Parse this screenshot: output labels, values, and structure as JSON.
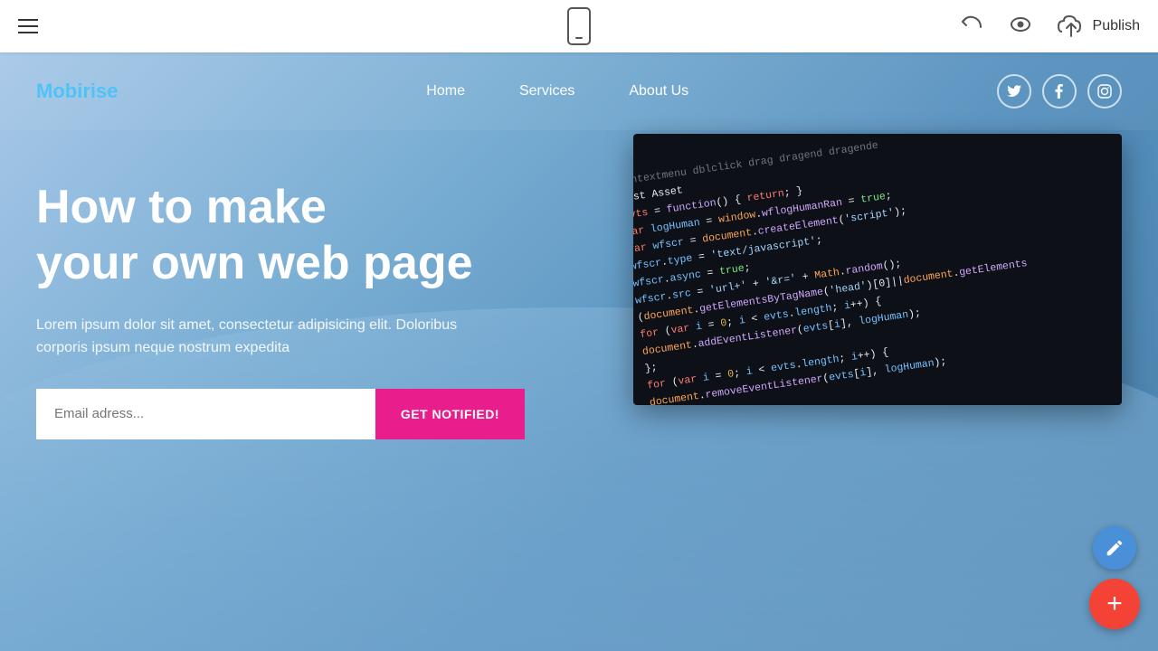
{
  "toolbar": {
    "publish_label": "Publish"
  },
  "site": {
    "logo": "Mobirise",
    "nav": {
      "home": "Home",
      "services": "Services",
      "about_us": "About Us"
    },
    "hero": {
      "title_line1": "How to make",
      "title_line2": "your own web page",
      "subtitle": "Lorem ipsum dolor sit amet, consectetur adipisicing elit. Doloribus corporis ipsum neque nostrum expedita",
      "email_placeholder": "Email adress...",
      "notify_btn": "GET NOTIFIED!"
    }
  },
  "social": {
    "twitter": "T",
    "facebook": "f",
    "instagram": "in"
  },
  "fabs": {
    "pencil": "✏",
    "add": "+"
  }
}
